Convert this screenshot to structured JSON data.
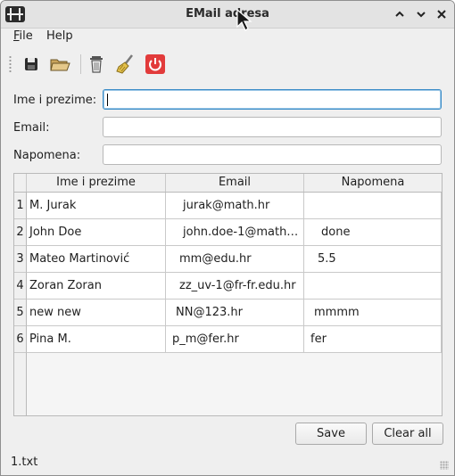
{
  "window": {
    "title": "EMail adresa"
  },
  "menu": {
    "items": [
      {
        "mnemonic": "F",
        "rest": "ile"
      },
      {
        "label": "Help"
      }
    ]
  },
  "toolbar": {
    "icons": [
      "save-icon",
      "open-folder-icon",
      "delete-icon",
      "clear-broom-icon",
      "power-icon"
    ]
  },
  "form": {
    "name_label": "Ime i prezime:",
    "email_label": "Email:",
    "note_label": "Napomena:",
    "name_value": "",
    "email_value": "",
    "note_value": ""
  },
  "table": {
    "headers": [
      "Ime i prezime",
      "Email",
      "Napomena"
    ],
    "rows": [
      {
        "num": "1",
        "name": "M. Jurak",
        "email": "jurak@math.hr",
        "note": ""
      },
      {
        "num": "2",
        "name": "John Doe",
        "email": "john.doe-1@math…",
        "note": "done"
      },
      {
        "num": "3",
        "name": "Mateo Martinović",
        "email": "mm@edu.hr",
        "note": "5.5"
      },
      {
        "num": "4",
        "name": "Zoran Zoran",
        "email": "zz_uv-1@fr-fr.edu.hr",
        "note": ""
      },
      {
        "num": "5",
        "name": "new new",
        "email": "NN@123.hr",
        "note": "mmmm"
      },
      {
        "num": "6",
        "name": "Pina M.",
        "email": "p_m@fer.hr",
        "note": "fer"
      }
    ]
  },
  "buttons": {
    "save": "Save",
    "clear_all": "Clear all"
  },
  "status": {
    "file": "1.txt"
  },
  "colors": {
    "accent": "#3a8cc7",
    "power_red": "#e23b3b"
  }
}
